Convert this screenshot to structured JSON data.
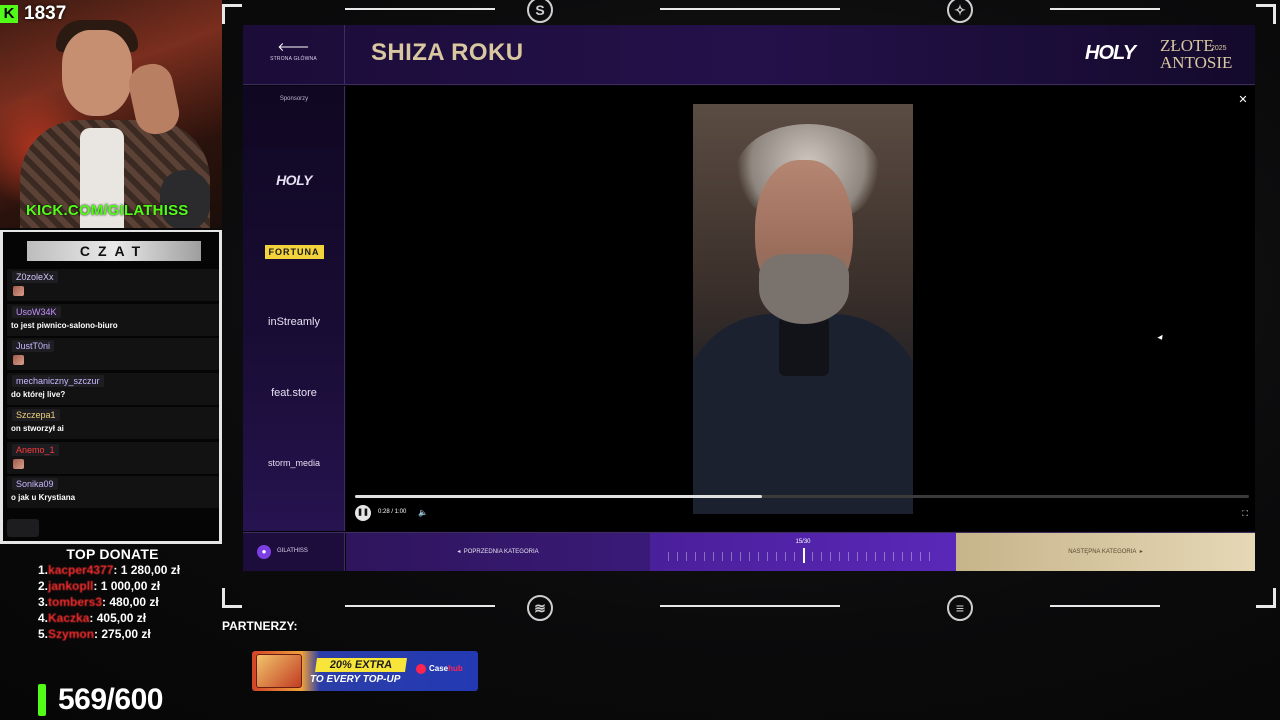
{
  "stream": {
    "kick_followers": "1837",
    "kick_url": "KICK.COM/GILATHISS",
    "chat_title": "CZAT",
    "viewers": "569/600"
  },
  "chat": {
    "messages": [
      {
        "user": "Z0zoleXx",
        "user_color": "#d8c8ff",
        "text": "",
        "emote": true
      },
      {
        "user": "UsoW34K",
        "user_color": "#c792ff",
        "text": "to jest piwnico-salono-biuro",
        "emote": false
      },
      {
        "user": "JustT0ni",
        "user_color": "#c8b8ff",
        "text": "",
        "emote": true
      },
      {
        "user": "mechaniczny_szczur",
        "user_color": "#c8b8ff",
        "text": "do której live?",
        "emote": false
      },
      {
        "user": "Szczepa1",
        "user_color": "#f1d07a",
        "text": "on stworzył ai",
        "emote": false
      },
      {
        "user": "Anemo_1",
        "user_color": "#ff3b3b",
        "text": "",
        "emote": true
      },
      {
        "user": "Sonika09",
        "user_color": "#c8b8ff",
        "text": "o jak u Krystiana",
        "emote": false
      }
    ]
  },
  "donations": {
    "title": "TOP DONATE",
    "items": [
      {
        "rank": "1.",
        "name": "kacper4377",
        "amount": ": 1 280,00 zł"
      },
      {
        "rank": "2.",
        "name": "jankopll",
        "amount": ": 1 000,00 zł"
      },
      {
        "rank": "3.",
        "name": "tombers3",
        "amount": ": 480,00 zł"
      },
      {
        "rank": "4.",
        "name": "Kaczka",
        "amount": ": 405,00 zł"
      },
      {
        "rank": "5.",
        "name": "Szymon",
        "amount": ": 275,00 zł"
      }
    ]
  },
  "partners": {
    "label": "PARTNERZY:",
    "promo_line1": "20% EXTRA",
    "promo_line2": "TO EVERY TOP-UP",
    "promo_brand_a": "Case",
    "promo_brand_b": "hub"
  },
  "app": {
    "home_label": "STRONA GŁÓWNA",
    "home_icon": "arrow-left-icon",
    "title": "SHIZA ROKU",
    "brand_holy": "HOLY",
    "brand_line1": "ZŁOTE",
    "brand_line2": "ANTOSIE",
    "brand_year": "2025",
    "sponsors_header": "Sponsorzy",
    "sponsors": [
      "HOLY",
      "FORTUNA",
      "inStreamly",
      "feat.store",
      "storm_media"
    ],
    "player": {
      "time": "0:28 / 1:00",
      "progress": 0.455,
      "close_icon": "close-icon",
      "play_icon": "pause-icon",
      "volume_icon": "volume-icon",
      "fullscreen_icon": "fullscreen-icon"
    },
    "footer": {
      "username": "GILATHISS",
      "prev": "POPRZEDNIA KATEGORIA",
      "counter": "15/30",
      "counter_fraction": 0.5,
      "next": "NASTĘPNA KATEGORIA"
    }
  },
  "colors": {
    "kick_green": "#53fc18",
    "title_gold": "#d9c7a0",
    "purple": "#4a1f9a",
    "donor_red": "#ff2e2e"
  }
}
